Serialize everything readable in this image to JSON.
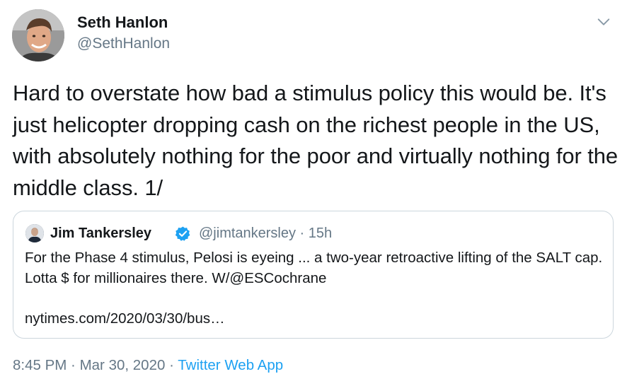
{
  "tweet": {
    "author": {
      "name": "Seth Hanlon",
      "handle": "@SethHanlon"
    },
    "text": "Hard to overstate how bad a stimulus policy this would be. It's just helicopter dropping cash on the richest people in the US, with absolutely nothing for the poor and virtually nothing for the middle class.  1/",
    "quoted": {
      "name": "Jim Tankersley",
      "verified": true,
      "meta": "@jimtankersley · 15h",
      "text": "For the Phase 4 stimulus, Pelosi is eyeing ... a two-year retroactive lifting of the SALT cap. Lotta $ for millionaires there. W/@ESCochrane",
      "link": "nytimes.com/2020/03/30/bus…"
    },
    "footer": {
      "time": "8:45 PM",
      "separator": " · ",
      "date": "Mar 30, 2020",
      "source": "Twitter Web App"
    }
  },
  "icons": {
    "more": "chevron-down-icon",
    "verified": "verified-badge-icon"
  },
  "colors": {
    "text": "#14171a",
    "secondary": "#657786",
    "accent": "#1da1f2",
    "border": "#ccd6dd"
  }
}
